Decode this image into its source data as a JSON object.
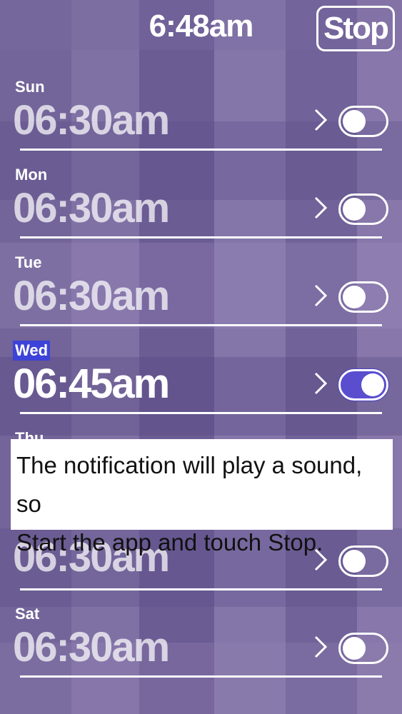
{
  "header": {
    "current_time": "6:48am",
    "stop_label": "Stop"
  },
  "alarms": [
    {
      "day": "Sun",
      "time": "06:30am",
      "enabled": false,
      "selected": false
    },
    {
      "day": "Mon",
      "time": "06:30am",
      "enabled": false,
      "selected": false
    },
    {
      "day": "Tue",
      "time": "06:30am",
      "enabled": false,
      "selected": false
    },
    {
      "day": "Wed",
      "time": "06:45am",
      "enabled": true,
      "selected": true
    },
    {
      "day": "Thu",
      "time": "06:30am",
      "enabled": false,
      "selected": false
    },
    {
      "day": "Sat",
      "time": "06:30am",
      "enabled": false,
      "selected": false
    }
  ],
  "notice": {
    "line1": "The notification will play a sound, so",
    "line2": "Start the app and touch Stop."
  },
  "icons": {
    "chevron": "chevron-right-icon",
    "toggle": "toggle-switch"
  },
  "colors": {
    "background": "#7a6b9e",
    "selected_day": "#3d43d8",
    "toggle_on": "#5a4ecf"
  }
}
